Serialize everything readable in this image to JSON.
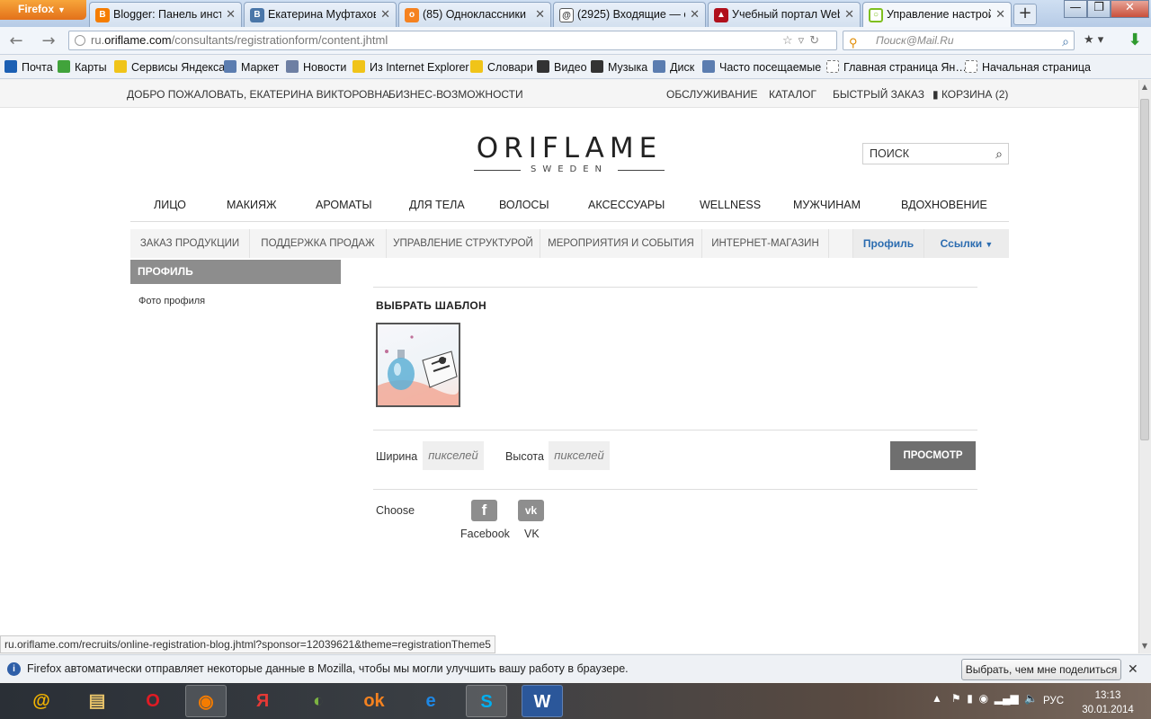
{
  "browser": {
    "menu_button": "Firefox",
    "tabs": [
      {
        "label": "Blogger: Панель инст…",
        "icon": "B",
        "color": "#f57d00"
      },
      {
        "label": "Екатерина Муфтахова",
        "icon": "В",
        "color": "#4a76a8"
      },
      {
        "label": "(85) Одноклассники",
        "icon": "ok",
        "color": "#f58220"
      },
      {
        "label": "(2925) Входящие — е…",
        "icon": "@",
        "color": "#555555"
      },
      {
        "label": "Учебный портал Web…",
        "icon": "▲",
        "color": "#b0101c"
      },
      {
        "label": "Управление настрой…",
        "icon": "○",
        "color": "#7fbf1f"
      }
    ],
    "new_tab": "+",
    "window_buttons": [
      "—",
      "❐",
      "✕"
    ],
    "url": {
      "prefix": "ru.",
      "host": "oriflame.com",
      "path": "/consultants/registrationform/content.jhtml"
    },
    "search_placeholder": "Поиск@Mail.Ru",
    "bookmarks": [
      {
        "label": "Почта",
        "color": "#1b5fb3"
      },
      {
        "label": "Карты",
        "color": "#41a33b"
      },
      {
        "label": "Сервисы Яндекса",
        "color": "#f0c419"
      },
      {
        "label": "Маркет",
        "color": "#5b7db0"
      },
      {
        "label": "Новости",
        "color": "#6d7fa3"
      },
      {
        "label": "Из Internet Explorer",
        "color": "#f0c419"
      },
      {
        "label": "Словари",
        "color": "#f0c419"
      },
      {
        "label": "Видео",
        "color": "#333333"
      },
      {
        "label": "Музыка",
        "color": "#333333"
      },
      {
        "label": "Диск",
        "color": "#5b7db0"
      },
      {
        "label": "Часто посещаемые",
        "color": "#5b7db0"
      },
      {
        "label": "Главная страница Ян…",
        "color": "#ffffff"
      },
      {
        "label": "Начальная страница",
        "color": "#ffffff"
      }
    ]
  },
  "site": {
    "top_left": [
      "ДОБРО ПОЖАЛОВАТЬ,  ЕКАТЕРИНА ВИКТОРОВНА",
      "БИЗНЕС-ВОЗМОЖНОСТИ"
    ],
    "top_right": [
      "ОБСЛУЖИВАНИЕ",
      "КАТАЛОГ",
      "БЫСТРЫЙ ЗАКАЗ"
    ],
    "cart": "КОРЗИНА (2)",
    "logo": {
      "main": "ORIFLAME",
      "sub": "SWEDEN"
    },
    "search_placeholder": "ПОИСК",
    "categories": [
      "ЛИЦО",
      "МАКИЯЖ",
      "АРОМАТЫ",
      "ДЛЯ ТЕЛА",
      "ВОЛОСЫ",
      "АКСЕССУАРЫ",
      "WELLNESS",
      "МУЖЧИНАМ",
      "ВДОХНОВЕНИЕ"
    ],
    "subnav": [
      "ЗАКАЗ ПРОДУКЦИИ",
      "ПОДДЕРЖКА ПРОДАЖ",
      "УПРАВЛЕНИЕ СТРУКТУРОЙ",
      "МЕРОПРИЯТИЯ И СОБЫТИЯ",
      "ИНТЕРНЕТ-МАГАЗИН"
    ],
    "profile_tab": "Профиль",
    "links_tab": "Ссылки",
    "sidebar": {
      "header": "ПРОФИЛЬ",
      "items": [
        "Фото профиля"
      ]
    },
    "main": {
      "template_title": "ВЫБРАТЬ ШАБЛОН",
      "width_label": "Ширина",
      "height_label": "Высота",
      "pixels_placeholder": "пикселей",
      "preview_button": "ПРОСМОТР",
      "choose_label": "Choose",
      "social": [
        {
          "label": "Facebook",
          "glyph": "f"
        },
        {
          "label": "VK",
          "glyph": "vk"
        }
      ]
    }
  },
  "status_url": "ru.oriflame.com/recruits/online-registration-blog.jhtml?sponsor=12039621&theme=registrationTheme5",
  "infobar": {
    "text": "Firefox автоматически отправляет некоторые данные в Mozilla, чтобы мы могли улучшить вашу работу в браузере.",
    "button": "Выбрать, чем мне поделиться"
  },
  "taskbar": {
    "apps": [
      {
        "name": "mail-agent",
        "glyph": "@",
        "color": "#f4b400"
      },
      {
        "name": "explorer",
        "glyph": "▤",
        "color": "#e9c46a"
      },
      {
        "name": "opera",
        "glyph": "O",
        "color": "#e01b24"
      },
      {
        "name": "firefox",
        "glyph": "◉",
        "color": "#f57c00"
      },
      {
        "name": "yandex",
        "glyph": "Я",
        "color": "#e53935"
      },
      {
        "name": "picasa",
        "glyph": "◐",
        "color": "#7cb342"
      },
      {
        "name": "odnoklassniki",
        "glyph": "ok",
        "color": "#f58220"
      },
      {
        "name": "internet-explorer",
        "glyph": "e",
        "color": "#1e88e5"
      },
      {
        "name": "skype",
        "glyph": "S",
        "color": "#00aff0"
      },
      {
        "name": "word",
        "glyph": "W",
        "color": "#2b579a"
      }
    ],
    "lang": "РУС",
    "time": "13:13",
    "date": "30.01.2014"
  }
}
